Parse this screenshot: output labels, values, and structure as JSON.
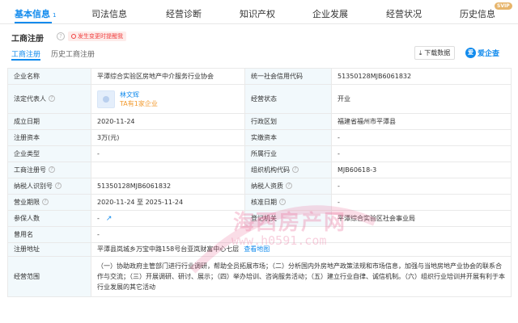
{
  "nav": {
    "tabs": [
      {
        "label": "基本信息",
        "count": "1"
      },
      {
        "label": "司法信息"
      },
      {
        "label": "经营诊断"
      },
      {
        "label": "知识产权"
      },
      {
        "label": "企业发展"
      },
      {
        "label": "经营状况"
      },
      {
        "label": "历史信息"
      }
    ],
    "svip_badge": "SVIP"
  },
  "section": {
    "title": "工商注册",
    "alert": "发生变更时提醒我"
  },
  "subtabs": [
    "工商注册",
    "历史工商注册"
  ],
  "download_label": "下载数据",
  "logo_text": "爱企查",
  "logo_mark": "爱",
  "table": {
    "company_name_label": "企业名称",
    "company_name": "平潭综合实验区房地产中介服务行业协会",
    "credit_code_label": "统一社会信用代码",
    "credit_code": "51350128MJB6061832",
    "legal_rep_label": "法定代表人",
    "legal_rep_name": "林文辉",
    "legal_rep_companies": "TA有1家企业",
    "status_label": "经营状态",
    "status": "开业",
    "founded_label": "成立日期",
    "founded": "2020-11-24",
    "region_label": "行政区划",
    "region": "福建省福州市平潭县",
    "reg_capital_label": "注册资本",
    "reg_capital": "3万(元)",
    "paid_capital_label": "实缴资本",
    "paid_capital": "-",
    "company_type_label": "企业类型",
    "company_type": "-",
    "industry_label": "所属行业",
    "industry": "-",
    "reg_no_label": "工商注册号",
    "reg_no": "",
    "org_code_label": "组织机构代码",
    "org_code": "MJB60618-3",
    "taxpayer_id_label": "纳税人识别号",
    "taxpayer_id": "51350128MJB6061832",
    "taxpayer_qual_label": "纳税人资质",
    "taxpayer_qual": "-",
    "term_label": "营业期限",
    "term": "2020-11-24 至 2025-11-24",
    "approval_date_label": "核准日期",
    "approval_date": "-",
    "insured_label": "参保人数",
    "insured": "-",
    "authority_label": "登记机关",
    "authority": "平潭综合实验区社会事业局",
    "former_name_label": "曾用名",
    "former_name": "-",
    "address_label": "注册地址",
    "address": "平潭县岚城乡万宝中路158号台亚岚财富中心七层",
    "map_link": "查看地图",
    "scope_label": "经营范围",
    "scope": "（一）协助政府主管部门进行行业调研，帮助全员拓展市场；（二）分析国内外房地产政策法规和市场信息，加强与当地房地产业协会的联系合作与交流；（三）开展调研、研讨、展示；（四）举办培训、咨询服务活动；（五）建立行业自律、诚信机制。（六）组织行业培训并开展有利于本行业发展的其它活动"
  },
  "watermark": {
    "text": "海西房产网",
    "url": "www.h0591.com"
  }
}
